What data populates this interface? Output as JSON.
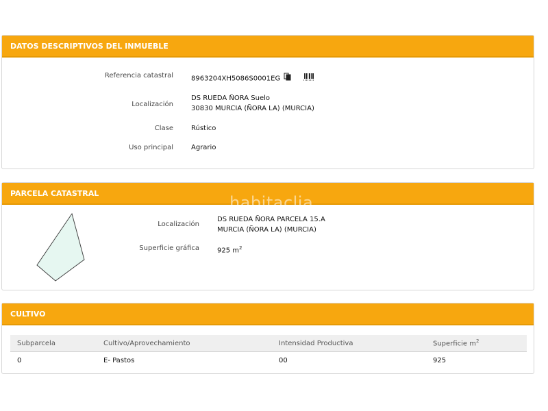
{
  "datos": {
    "header": "DATOS DESCRIPTIVOS DEL INMUEBLE",
    "rows": [
      {
        "label": "Referencia catastral",
        "value": "8963204XH5086S0001EG"
      },
      {
        "label": "Localización",
        "value_line1": "DS RUEDA ÑORA Suelo",
        "value_line2": "30830 MURCIA (ÑORA LA) (MURCIA)"
      },
      {
        "label": "Clase",
        "value": "Rústico"
      },
      {
        "label": "Uso principal",
        "value": "Agrario"
      }
    ],
    "icons": [
      "copy-icon",
      "barcode-icon"
    ]
  },
  "parcela": {
    "header": "PARCELA CATASTRAL",
    "localizacion_label": "Localización",
    "localizacion_line1": "DS RUEDA ÑORA PARCELA 15.A",
    "localizacion_line2": "MURCIA (ÑORA LA) (MURCIA)",
    "superficie_label": "Superficie gráfica",
    "superficie_value": "925 m",
    "superficie_unit_exp": "2",
    "shape_fill": "#e6f7f1",
    "shape_stroke": "#444444"
  },
  "cultivo": {
    "header": "CULTIVO",
    "columns": [
      "Subparcela",
      "Cultivo/Aprovechamiento",
      "Intensidad Productiva",
      "Superficie m"
    ],
    "superficie_exp": "2",
    "rows": [
      [
        "0",
        "E- Pastos",
        "00",
        "925"
      ]
    ]
  },
  "watermark": "habitaclia",
  "colors": {
    "header_bg": "#f7a70f",
    "header_text": "#ffffff"
  }
}
